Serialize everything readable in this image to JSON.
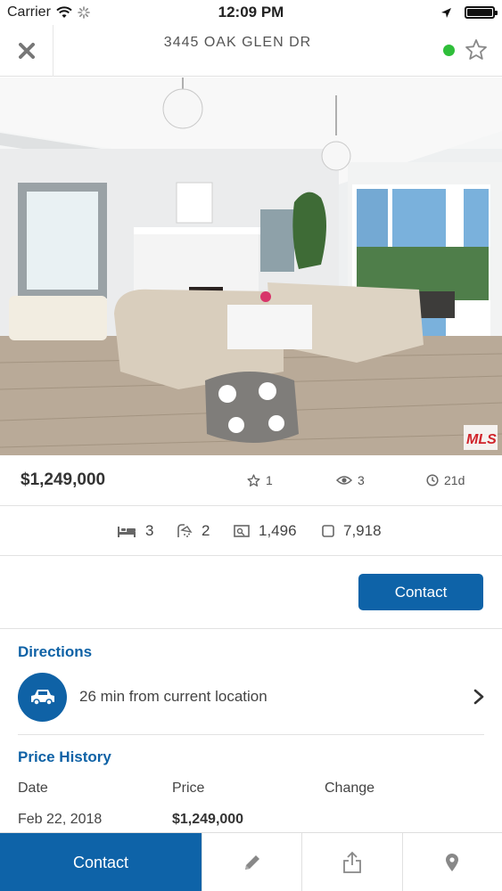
{
  "status_bar": {
    "carrier": "Carrier",
    "time": "12:09 PM"
  },
  "header": {
    "title": "3445 OAK GLEN DR",
    "close_icon": "close-icon",
    "favorite_icon": "star-outline-icon",
    "status_color": "#2fbe3a"
  },
  "photo": {
    "watermark": "MLS"
  },
  "summary": {
    "price": "$1,249,000",
    "favorites": "1",
    "views": "3",
    "days_on_market": "21d"
  },
  "facts": {
    "beds": "3",
    "baths": "2",
    "sqft": "1,496",
    "lot": "7,918"
  },
  "contact_button": "Contact",
  "directions": {
    "title": "Directions",
    "text": "26 min from current location"
  },
  "price_history": {
    "title": "Price History",
    "columns": [
      "Date",
      "Price",
      "Change"
    ],
    "rows": [
      {
        "date": "Feb 22, 2018",
        "price": "$1,249,000",
        "change": ""
      }
    ]
  },
  "tab_bar": {
    "contact_label": "Contact",
    "icons": [
      "pencil-icon",
      "share-icon",
      "map-pin-icon"
    ]
  },
  "colors": {
    "accent": "#0e63a8",
    "section_title": "#0f62a6"
  }
}
